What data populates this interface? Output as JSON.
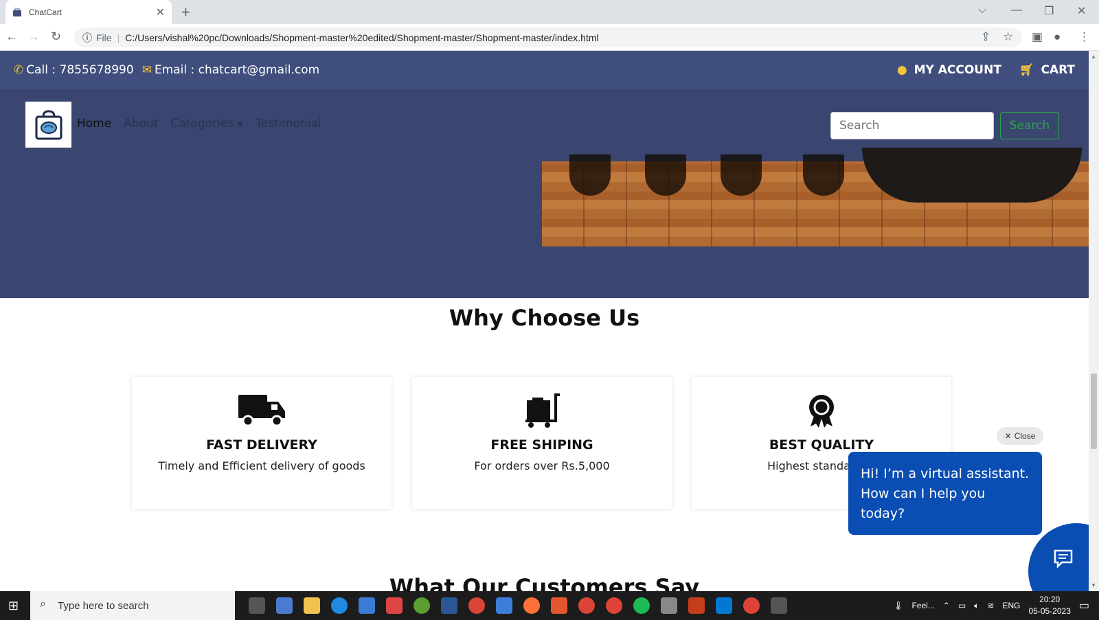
{
  "browser": {
    "tab_title": "ChatCart",
    "address_prefix": "File",
    "url": "C:/Users/vishal%20pc/Downloads/Shopment-master%20edited/Shopment-master/Shopment-master/index.html"
  },
  "topbar": {
    "call": "Call : 7855678990",
    "email": "Email : chatcart@gmail.com",
    "account": "MY ACCOUNT",
    "cart": "CART"
  },
  "nav": {
    "items": [
      "Home",
      "About",
      "Categories",
      "Testimonial"
    ],
    "search_placeholder": "Search",
    "search_button": "Search"
  },
  "why": {
    "title": "Why Choose Us",
    "cards": [
      {
        "title": "FAST DELIVERY",
        "text": "Timely and Efficient delivery of goods",
        "icon": "truck-icon"
      },
      {
        "title": "FREE SHIPING",
        "text": "For orders over Rs.5,000",
        "icon": "dolly-icon"
      },
      {
        "title": "BEST QUALITY",
        "text": "Highest standard of",
        "icon": "award-icon"
      }
    ]
  },
  "testimonials": {
    "title": "What Our Customers Say"
  },
  "chat": {
    "close": "Close",
    "message": "Hi! I’m a virtual assistant. How can I help you today?"
  },
  "taskbar": {
    "search_placeholder": "Type here to search",
    "feel": "Feel...",
    "lang": "ENG",
    "time": "20:20",
    "date": "05-05-2023"
  },
  "colors": {
    "header": "#3f4e7d",
    "hero": "#3a4670",
    "accent": "#f3c33c",
    "chat": "#0a4db3",
    "search_green": "#28a745"
  }
}
